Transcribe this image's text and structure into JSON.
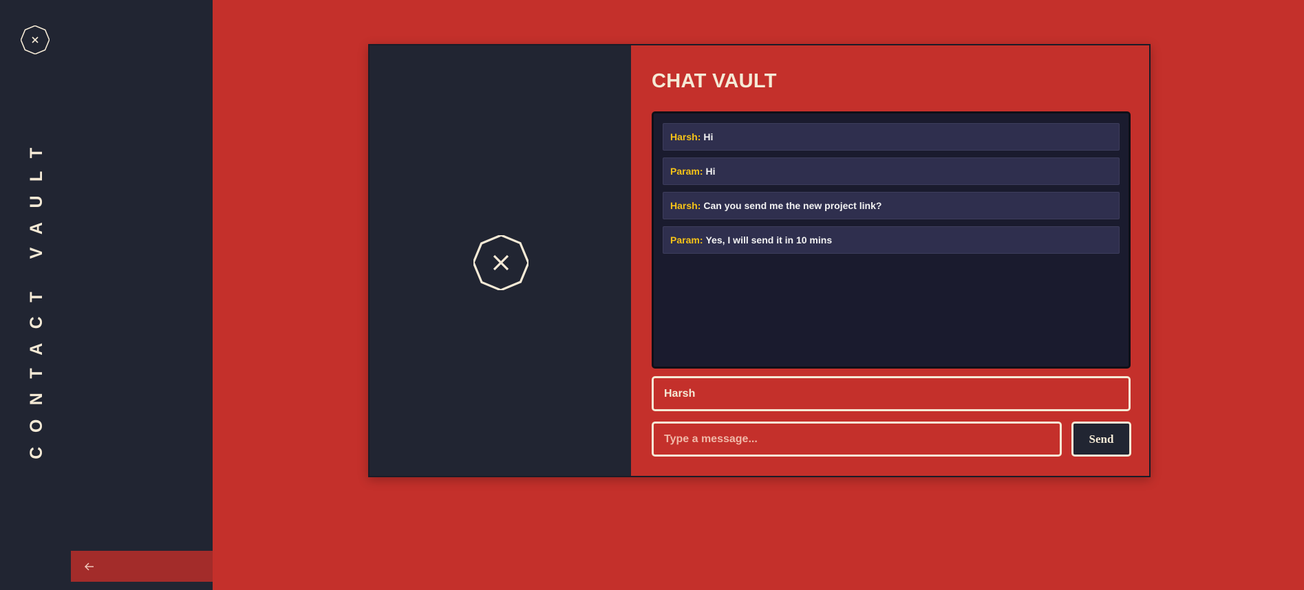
{
  "sidebar": {
    "logo_icon": "octagon-close-icon",
    "title": "CONTACT VAULT",
    "back_icon": "arrow-left-icon"
  },
  "card": {
    "logo_icon": "octagon-close-icon",
    "title": "CHAT VAULT",
    "messages": [
      {
        "sender": "Harsh",
        "text": "Hi"
      },
      {
        "sender": "Param",
        "text": "Hi"
      },
      {
        "sender": "Harsh",
        "text": "Can you send me the new project link?"
      },
      {
        "sender": "Param",
        "text": "Yes, I will send it in 10 mins"
      }
    ],
    "name_input": {
      "value": "Harsh"
    },
    "message_input": {
      "value": "",
      "placeholder": "Type a message..."
    },
    "send_label": "Send"
  },
  "colors": {
    "background": "#c4302b",
    "panel": "#212532",
    "chat_area": "#1a1b2e",
    "message_bubble": "#2f2f4e",
    "sender": "#f5c218",
    "cream": "#f5ead6"
  }
}
